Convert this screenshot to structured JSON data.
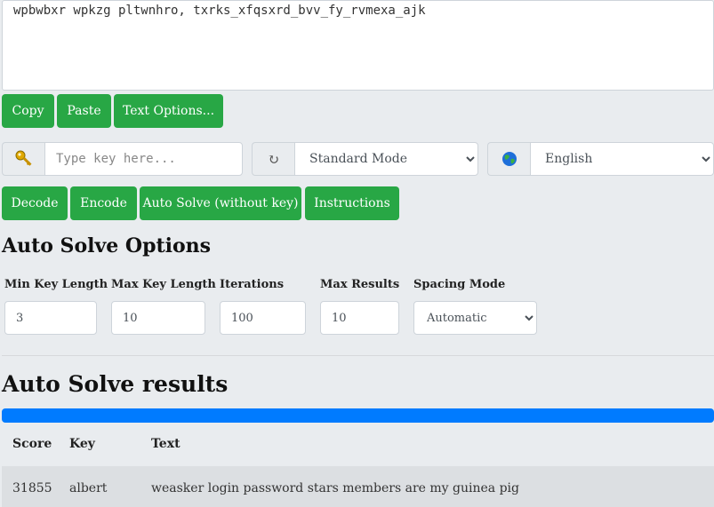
{
  "editor": {
    "text": "wpbwbxr wpkzg pltwnhro, txrks_xfqsxrd_bvv_fy_rvmexa_ajk"
  },
  "text_buttons": {
    "copy": "Copy",
    "paste": "Paste",
    "text_options": "Text Options..."
  },
  "key_input": {
    "icon": "key-icon",
    "placeholder": "Type key here..."
  },
  "mode_select": {
    "icon": "refresh-icon",
    "selected": "Standard Mode"
  },
  "language_select": {
    "icon": "globe-icon",
    "selected": "English"
  },
  "actions": {
    "decode": "Decode",
    "encode": "Encode",
    "auto_solve": "Auto Solve (without key)",
    "instructions": "Instructions"
  },
  "auto_solve_options": {
    "heading": "Auto Solve Options",
    "min_key_length": {
      "label": "Min Key Length",
      "value": "3"
    },
    "max_key_length": {
      "label": "Max Key Length",
      "value": "10"
    },
    "iterations": {
      "label": "Iterations",
      "value": "100"
    },
    "max_results": {
      "label": "Max Results",
      "value": "10"
    },
    "spacing_mode": {
      "label": "Spacing Mode",
      "selected": "Automatic"
    }
  },
  "results": {
    "heading": "Auto Solve results",
    "progress": 1.0,
    "progress_color": "#007bff",
    "columns": [
      "Score",
      "Key",
      "Text"
    ],
    "rows": [
      {
        "score": "31855",
        "key": "albert",
        "text": "weasker login password stars members are my guinea pig"
      }
    ]
  },
  "colors": {
    "button_green": "#28a745",
    "background": "#e9ecef"
  }
}
